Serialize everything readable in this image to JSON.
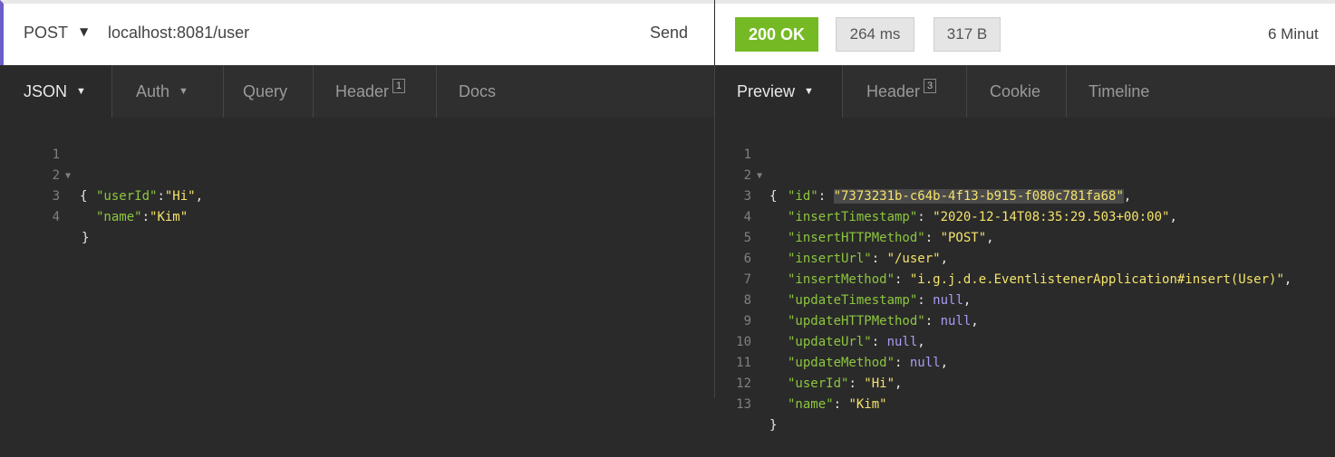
{
  "request": {
    "method": "POST",
    "url": "localhost:8081/user",
    "send_label": "Send",
    "tabs": [
      {
        "label": "JSON"
      },
      {
        "label": "Auth"
      },
      {
        "label": "Query"
      },
      {
        "label": "Header",
        "badge": "1"
      },
      {
        "label": "Docs"
      }
    ],
    "body_lines": [
      {
        "num": "1",
        "text": "{"
      },
      {
        "num": "2",
        "key": "\"userId\"",
        "value": "\"Hi\"",
        "suffix": ","
      },
      {
        "num": "3",
        "key": "\"name\"",
        "value": "\"Kim\"",
        "suffix": ""
      },
      {
        "num": "4",
        "text": "}"
      }
    ]
  },
  "response": {
    "status": "200 OK",
    "time": "264 ms",
    "size": "317 B",
    "age": "6 Minut",
    "colors": {
      "status_ok": "#75ba24",
      "accent": "#6c5fc7",
      "key": "#8dc63f",
      "string": "#f5e36b",
      "null": "#a99cf5"
    },
    "tabs": [
      {
        "label": "Preview"
      },
      {
        "label": "Header",
        "badge": "3"
      },
      {
        "label": "Cookie"
      },
      {
        "label": "Timeline"
      }
    ],
    "body_lines": [
      {
        "num": "1",
        "text": "{"
      },
      {
        "num": "2",
        "key": "\"id\"",
        "value": "\"7373231b-c64b-4f13-b915-f080c781fa68\"",
        "suffix": ","
      },
      {
        "num": "3",
        "key": "\"insertTimestamp\"",
        "value": "\"2020-12-14T08:35:29.503+00:00\"",
        "suffix": ","
      },
      {
        "num": "4",
        "key": "\"insertHTTPMethod\"",
        "value": "\"POST\"",
        "suffix": ","
      },
      {
        "num": "5",
        "key": "\"insertUrl\"",
        "value": "\"/user\"",
        "suffix": ","
      },
      {
        "num": "6",
        "key": "\"insertMethod\"",
        "value": "\"i.g.j.d.e.EventlistenerApplication#insert(User)\"",
        "suffix": ","
      },
      {
        "num": "7",
        "key": "\"updateTimestamp\"",
        "value": "null",
        "suffix": ","
      },
      {
        "num": "8",
        "key": "\"updateHTTPMethod\"",
        "value": "null",
        "suffix": ","
      },
      {
        "num": "9",
        "key": "\"updateUrl\"",
        "value": "null",
        "suffix": ","
      },
      {
        "num": "10",
        "key": "\"updateMethod\"",
        "value": "null",
        "suffix": ","
      },
      {
        "num": "11",
        "key": "\"userId\"",
        "value": "\"Hi\"",
        "suffix": ","
      },
      {
        "num": "12",
        "key": "\"name\"",
        "value": "\"Kim\"",
        "suffix": ""
      },
      {
        "num": "13",
        "text": "}"
      }
    ]
  }
}
